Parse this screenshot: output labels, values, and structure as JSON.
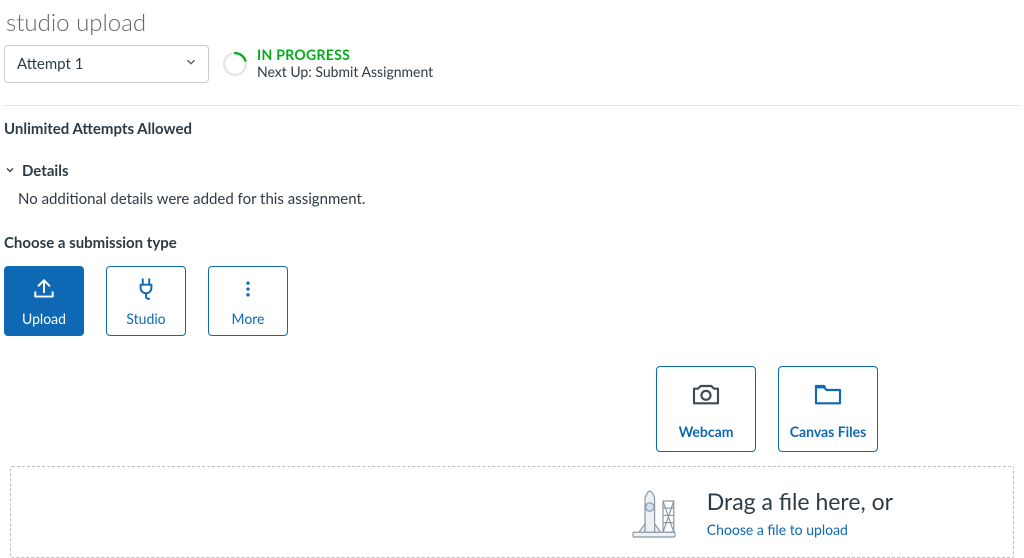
{
  "title": "studio upload",
  "attempt": {
    "selected": "Attempt 1"
  },
  "status": {
    "label": "IN PROGRESS",
    "next_up_prefix": "Next Up: ",
    "next_up": "Submit Assignment"
  },
  "attempts_note": "Unlimited Attempts Allowed",
  "details": {
    "header": "Details",
    "body": "No additional details were added for this assignment."
  },
  "submission": {
    "choose_label": "Choose a submission type",
    "types": {
      "upload": "Upload",
      "studio": "Studio",
      "more": "More"
    }
  },
  "sources": {
    "webcam": "Webcam",
    "canvas_files": "Canvas Files"
  },
  "dropzone": {
    "drag_text": "Drag a file here, or",
    "choose_text": "Choose a file to upload"
  }
}
